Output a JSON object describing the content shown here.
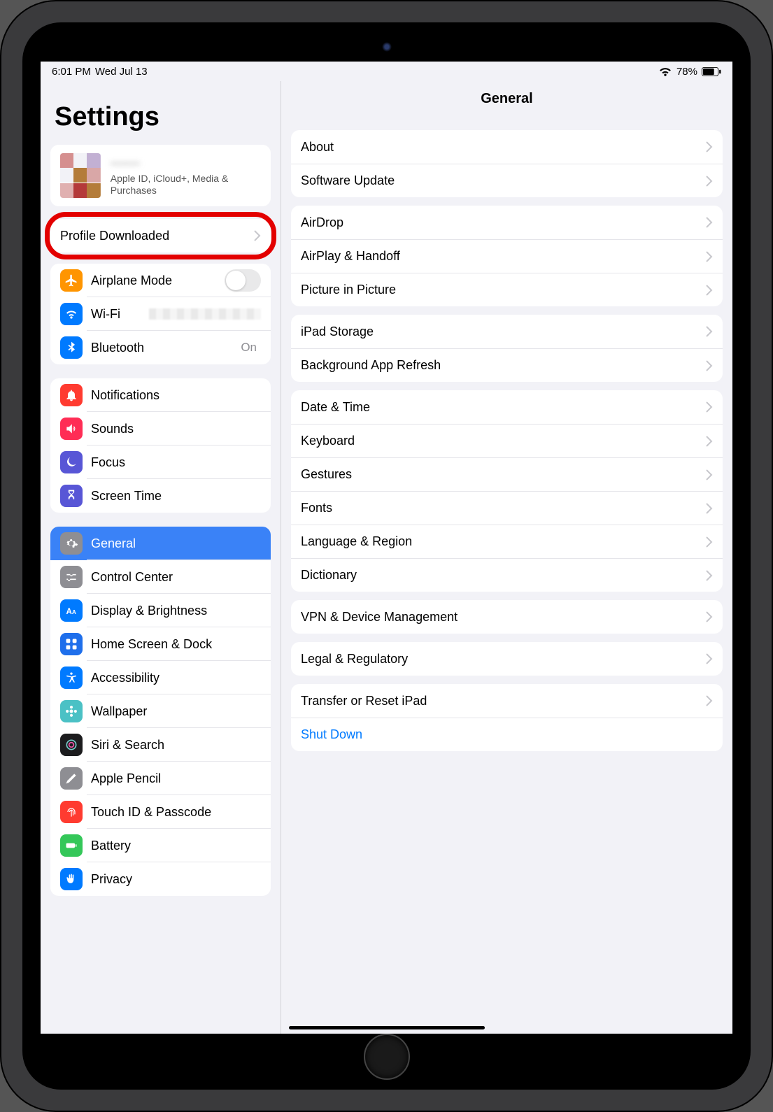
{
  "status": {
    "time": "6:01 PM",
    "date": "Wed Jul 13",
    "battery_pct": "78%"
  },
  "sidebar": {
    "title": "Settings",
    "account": {
      "name": "——",
      "subtitle": "Apple ID, iCloud+, Media & Purchases"
    },
    "profile_row_label": "Profile Downloaded",
    "group_radio": {
      "airplane": "Airplane Mode",
      "wifi": "Wi-Fi",
      "wifi_value": "",
      "bluetooth": "Bluetooth",
      "bluetooth_value": "On"
    },
    "group_notify": {
      "notifications": "Notifications",
      "sounds": "Sounds",
      "focus": "Focus",
      "screentime": "Screen Time"
    },
    "group_general": {
      "general": "General",
      "control_center": "Control Center",
      "display": "Display & Brightness",
      "home": "Home Screen & Dock",
      "accessibility": "Accessibility",
      "wallpaper": "Wallpaper",
      "siri": "Siri & Search",
      "pencil": "Apple Pencil",
      "touchid": "Touch ID & Passcode",
      "battery": "Battery",
      "privacy": "Privacy"
    }
  },
  "detail": {
    "title": "General",
    "g1": {
      "about": "About",
      "software_update": "Software Update"
    },
    "g2": {
      "airdrop": "AirDrop",
      "airplay": "AirPlay & Handoff",
      "pip": "Picture in Picture"
    },
    "g3": {
      "storage": "iPad Storage",
      "bg_refresh": "Background App Refresh"
    },
    "g4": {
      "datetime": "Date & Time",
      "keyboard": "Keyboard",
      "gestures": "Gestures",
      "fonts": "Fonts",
      "lang": "Language & Region",
      "dict": "Dictionary"
    },
    "g5": {
      "vpn": "VPN & Device Management"
    },
    "g6": {
      "legal": "Legal & Regulatory"
    },
    "g7": {
      "transfer": "Transfer or Reset iPad",
      "shutdown": "Shut Down"
    }
  }
}
